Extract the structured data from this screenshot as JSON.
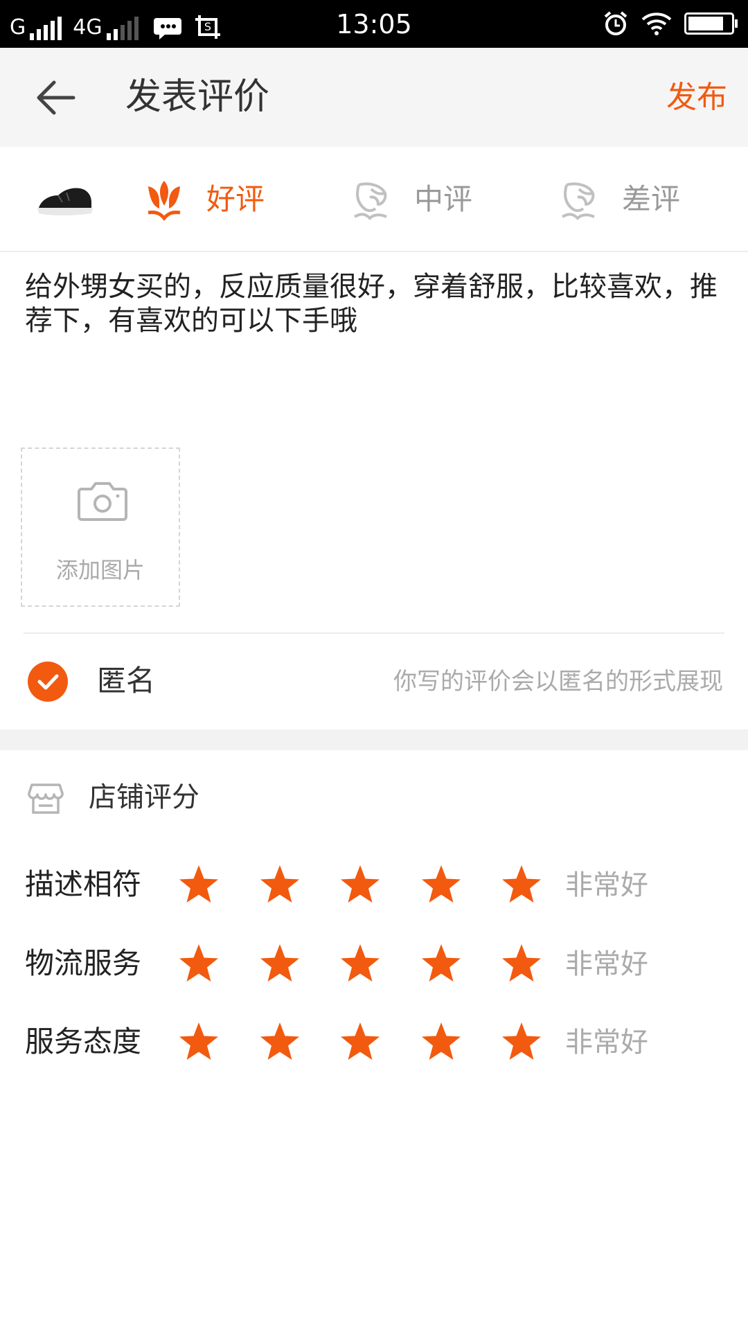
{
  "status_bar": {
    "carrier1": "G",
    "carrier2": "4G",
    "time": "13:05",
    "battery_level_pct": 90
  },
  "header": {
    "title": "发表评价",
    "publish_label": "发布"
  },
  "rating_options": [
    {
      "label": "好评",
      "selected": true
    },
    {
      "label": "中评",
      "selected": false
    },
    {
      "label": "差评",
      "selected": false
    }
  ],
  "review": {
    "text": "给外甥女买的，反应质量很好，穿着舒服，比较喜欢，推荐下，有喜欢的可以下手哦"
  },
  "add_photo": {
    "label": "添加图片"
  },
  "anonymous": {
    "label": "匿名",
    "checked": true,
    "hint": "你写的评价会以匿名的形式展现"
  },
  "shop_rating": {
    "title": "店铺评分",
    "rows": [
      {
        "label": "描述相符",
        "stars": 5,
        "max_stars": 5,
        "text": "非常好"
      },
      {
        "label": "物流服务",
        "stars": 5,
        "max_stars": 5,
        "text": "非常好"
      },
      {
        "label": "服务态度",
        "stars": 5,
        "max_stars": 5,
        "text": "非常好"
      }
    ]
  },
  "colors": {
    "accent": "#f25a0f",
    "muted": "#aaaaaa",
    "header_bg": "#f5f5f5"
  }
}
